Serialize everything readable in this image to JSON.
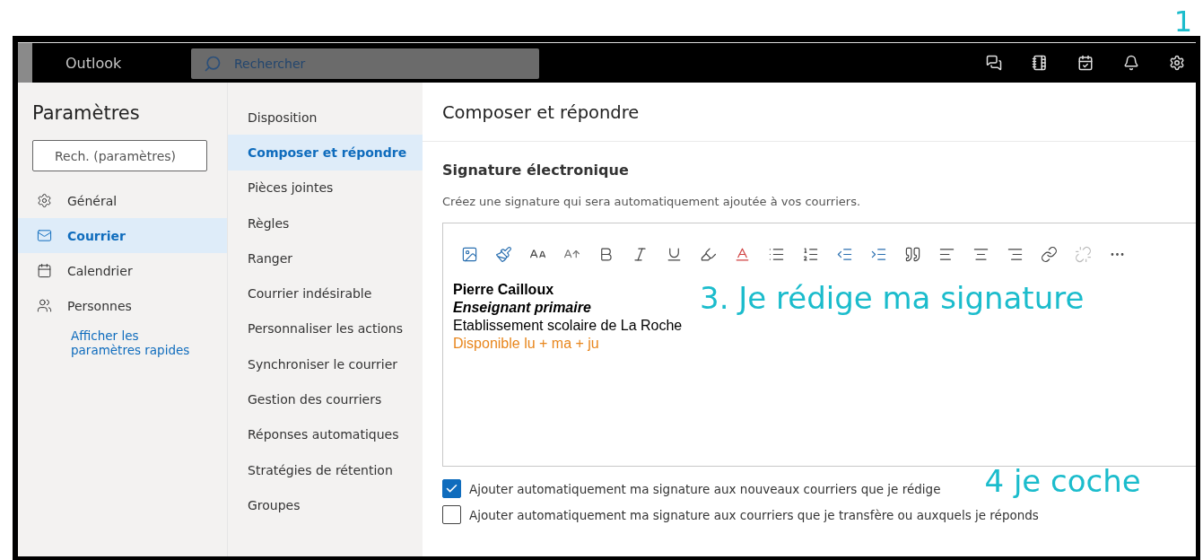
{
  "annotations": {
    "step_1": "1",
    "step_3": "3. Je rédige ma signature",
    "step_4": "4 je coche"
  },
  "topbar": {
    "app_name": "Outlook",
    "search": {
      "placeholder": "Rechercher"
    }
  },
  "settings": {
    "title": "Paramètres",
    "search": {
      "placeholder": "Rech. (paramètres)"
    },
    "items": [
      {
        "label": "Général",
        "selected": false
      },
      {
        "label": "Courrier",
        "selected": true
      },
      {
        "label": "Calendrier",
        "selected": false
      },
      {
        "label": "Personnes",
        "selected": false
      }
    ],
    "quick_link": "Afficher les paramètres rapides"
  },
  "mail_menu": [
    {
      "label": "Disposition",
      "selected": false
    },
    {
      "label": "Composer et répondre",
      "selected": true
    },
    {
      "label": "Pièces jointes",
      "selected": false
    },
    {
      "label": "Règles",
      "selected": false
    },
    {
      "label": "Ranger",
      "selected": false
    },
    {
      "label": "Courrier indésirable",
      "selected": false
    },
    {
      "label": "Personnaliser les actions",
      "selected": false
    },
    {
      "label": "Synchroniser le courrier",
      "selected": false
    },
    {
      "label": "Gestion des courriers",
      "selected": false
    },
    {
      "label": "Réponses automatiques",
      "selected": false
    },
    {
      "label": "Stratégies de rétention",
      "selected": false
    },
    {
      "label": "Groupes",
      "selected": false
    }
  ],
  "content": {
    "title": "Composer et répondre",
    "section": "Signature électronique",
    "description": "Créez une signature qui sera automatiquement ajoutée à vos courriers.",
    "signature": [
      {
        "text": "Pierre Cailloux",
        "kind": "bold",
        "color": "#000000"
      },
      {
        "text": "Enseignant primaire",
        "kind": "bold-italic",
        "color": "#000000"
      },
      {
        "text": "Etablissement scolaire de La Roche",
        "kind": "plain",
        "color": "#000000"
      },
      {
        "text": "Disponible lu + ma + ju",
        "kind": "plain",
        "color": "#e8861d"
      }
    ],
    "options": [
      {
        "label": "Ajouter automatiquement ma signature aux nouveaux courriers que je rédige",
        "checked": true
      },
      {
        "label": "Ajouter automatiquement ma signature aux courriers que je transfère ou auxquels je réponds",
        "checked": false
      }
    ]
  }
}
